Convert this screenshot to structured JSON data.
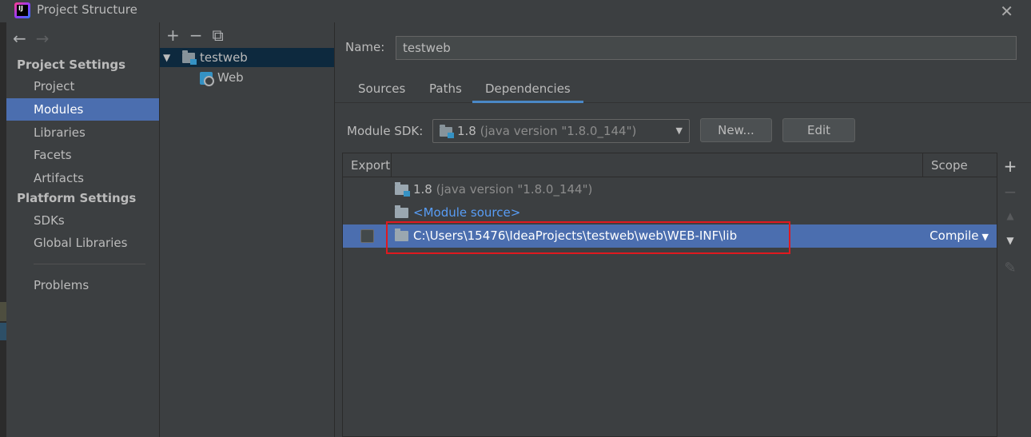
{
  "window": {
    "title": "Project Structure",
    "close": "✕",
    "app_icon_text": "IJ"
  },
  "nav": {
    "back": "←",
    "forward": "→",
    "project_settings_header": "Project Settings",
    "platform_settings_header": "Platform Settings",
    "items": [
      {
        "label": "Project"
      },
      {
        "label": "Modules"
      },
      {
        "label": "Libraries"
      },
      {
        "label": "Facets"
      },
      {
        "label": "Artifacts"
      },
      {
        "label": "SDKs"
      },
      {
        "label": "Global Libraries"
      },
      {
        "label": "Problems"
      }
    ],
    "selected": "Modules"
  },
  "tree": {
    "tools": {
      "add": "+",
      "remove": "−",
      "copy": "⧉"
    },
    "nodes": [
      {
        "label": "testweb",
        "expanded": true,
        "icon": "module-folder-icon"
      },
      {
        "label": "Web",
        "icon": "web-facet-icon"
      }
    ]
  },
  "module": {
    "name_label": "Name:",
    "name_value": "testweb",
    "tabs": [
      {
        "label": "Sources"
      },
      {
        "label": "Paths"
      },
      {
        "label": "Dependencies",
        "active": true
      }
    ],
    "sdk_label": "Module SDK:",
    "sdk_value": "1.8",
    "sdk_detail": "(java version \"1.8.0_144\")",
    "sdk_caret": "▼",
    "new_button": "New...",
    "edit_button": "Edit"
  },
  "dependencies": {
    "columns": {
      "export": "Export",
      "scope": "Scope"
    },
    "rows": [
      {
        "name": "1.8",
        "detail": "(java version \"1.8.0_144\")"
      },
      {
        "name": "<Module source>"
      },
      {
        "name": "C:\\Users\\15476\\IdeaProjects\\testweb\\web\\WEB-INF\\lib",
        "scope": "Compile",
        "exported": false,
        "selected": true
      }
    ],
    "scope_caret": "▼"
  },
  "side_tools": {
    "add": "+",
    "remove": "−",
    "up": "▲",
    "down": "▼",
    "edit": "✎"
  },
  "colors": {
    "background": "#3c3f41",
    "selection": "#4b6eaf",
    "tree_selection": "#0d293e",
    "link": "#589df6",
    "highlight_box": "#e0191f"
  }
}
